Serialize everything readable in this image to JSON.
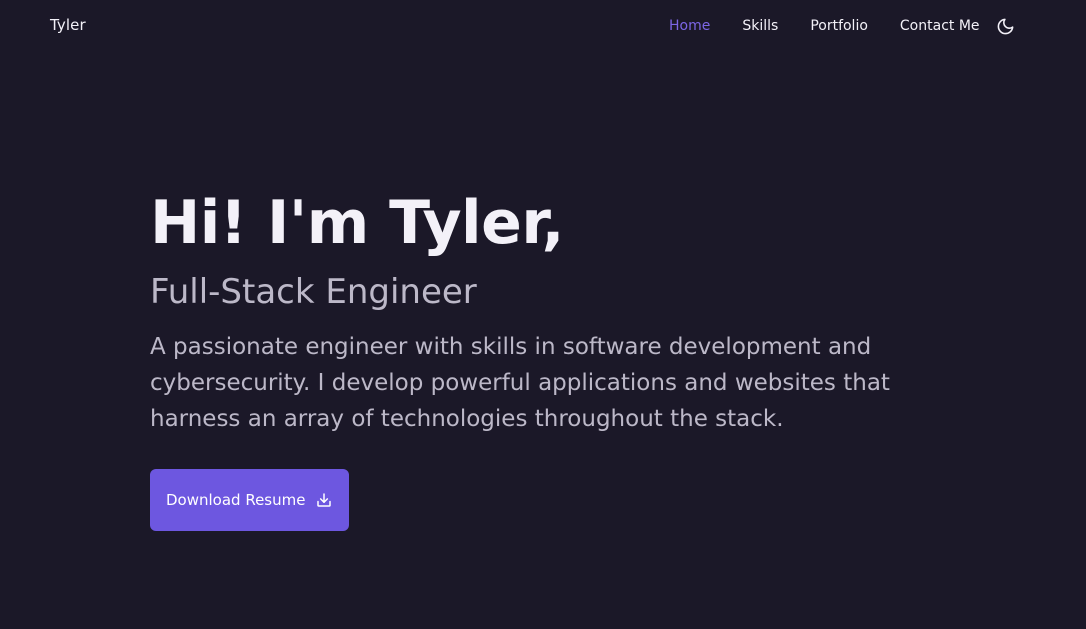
{
  "brand": {
    "name": "Tyler"
  },
  "nav": {
    "items": [
      {
        "label": "Home",
        "active": true
      },
      {
        "label": "Skills",
        "active": false
      },
      {
        "label": "Portfolio",
        "active": false
      },
      {
        "label": "Contact Me",
        "active": false
      }
    ],
    "theme_toggle_icon": "moon-icon"
  },
  "hero": {
    "greeting": "Hi! I'm Tyler,",
    "role": "Full-Stack Engineer",
    "description": "A passionate engineer with skills in software development and cybersecurity. I develop powerful applications and websites that harness an array of technologies throughout the stack.",
    "cta_label": "Download Resume",
    "cta_icon": "download-icon"
  },
  "colors": {
    "background": "#1b1828",
    "accent": "#6d57e0",
    "active_link": "#7c66e6",
    "text": "#f3f1f8",
    "muted_text": "#bcb8c8"
  }
}
